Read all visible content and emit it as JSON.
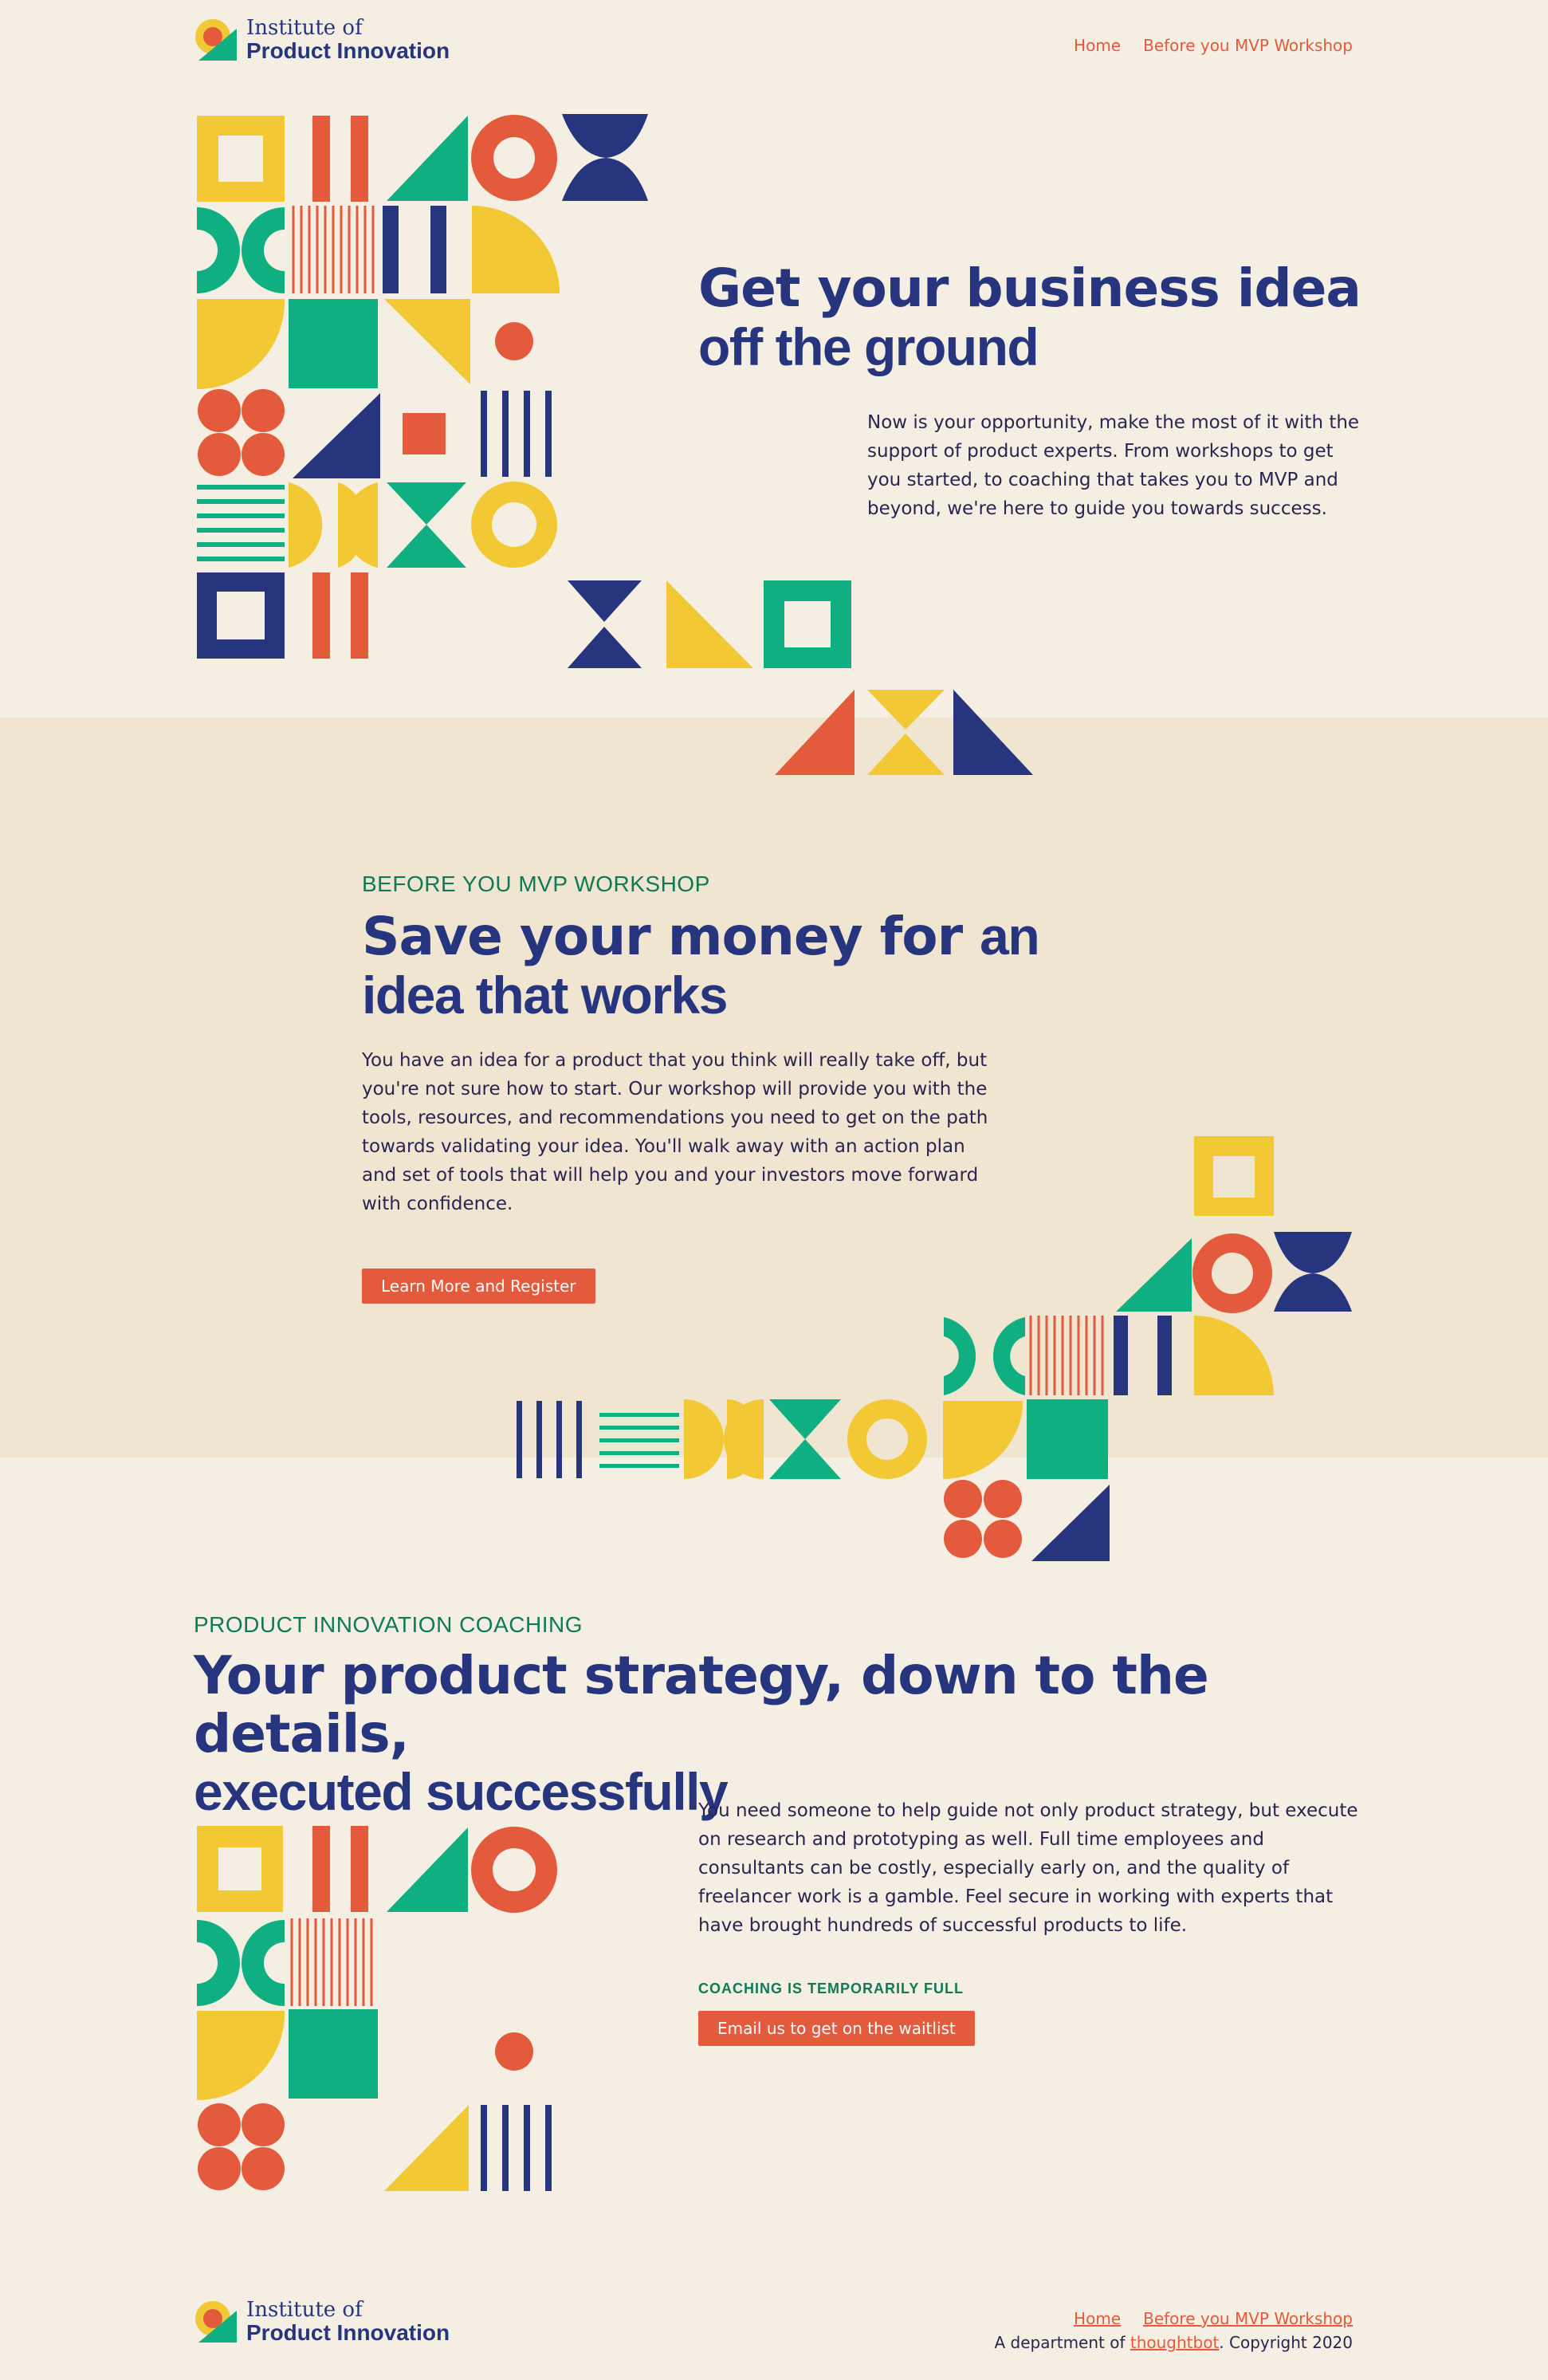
{
  "header": {
    "logo": {
      "line1": "Institute of",
      "line2": "Product Innovation"
    },
    "nav": [
      {
        "label": "Home"
      },
      {
        "label": "Before you MVP Workshop"
      }
    ]
  },
  "hero": {
    "headline_regular": "Get your business idea",
    "headline_bold": "off the ground",
    "body": "Now is your opportunity, make the most of it with the support of product experts. From workshops to get you started, to coaching that takes you to MVP and beyond, we're here to guide you towards success."
  },
  "workshop": {
    "eyebrow": "BEFORE YOU MVP WORKSHOP",
    "headline_regular": "Save your money for",
    "headline_bold_1": "an",
    "headline_bold_2": "idea that works",
    "body": "You have an idea for a product that you think will really take off, but you're not sure how to start. Our workshop will provide you with the tools, resources, and recommendations you need to get on the path towards validating your idea. You'll walk away with an action plan and set of tools that will help you and your investors move forward with confidence.",
    "button_label": "Learn More and Register"
  },
  "coaching": {
    "eyebrow": "PRODUCT INNOVATION COACHING",
    "headline_regular": "Your product strategy, down to the details,",
    "headline_bold": "executed successfully",
    "body": "You need someone to help guide not only product strategy, but execute on research and prototyping as well. Full time employees and consultants can be costly, especially early on, and the quality of freelancer work is a gamble. Feel secure in working with experts that have brought hundreds of successful products to life.",
    "status": "COACHING IS TEMPORARILY FULL",
    "button_label": "Email us to get on the waitlist"
  },
  "footer": {
    "logo": {
      "line1": "Institute of",
      "line2": "Product Innovation"
    },
    "links": [
      {
        "label": "Home"
      },
      {
        "label": "Before you MVP Workshop"
      }
    ],
    "credit_prefix": "A department of ",
    "credit_link": "thoughtbot",
    "credit_suffix": ". Copyright 2020"
  },
  "colors": {
    "background": "#f4efe2",
    "band": "#f0e5d0",
    "navy": "#26357e",
    "red": "#e45a3c",
    "green": "#0faf82",
    "yellow": "#f2c935",
    "eyebrow_green": "#0f7a55"
  }
}
